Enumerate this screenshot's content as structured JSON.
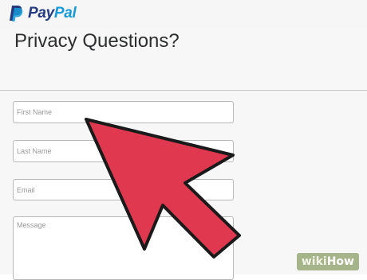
{
  "header": {
    "logo": {
      "part1": "Pay",
      "part2": "Pal"
    }
  },
  "page": {
    "title": "Privacy Questions?"
  },
  "form": {
    "first_name_placeholder": "First Name",
    "last_name_placeholder": "Last Name",
    "email_placeholder": "Email",
    "message_placeholder": "Message"
  },
  "overlay": {
    "arrow_color": "#e0394f"
  },
  "watermark": {
    "part1": "wiki",
    "part2": "How"
  },
  "colors": {
    "paypal_dark_blue": "#253b80",
    "paypal_light_blue": "#179bd7"
  }
}
